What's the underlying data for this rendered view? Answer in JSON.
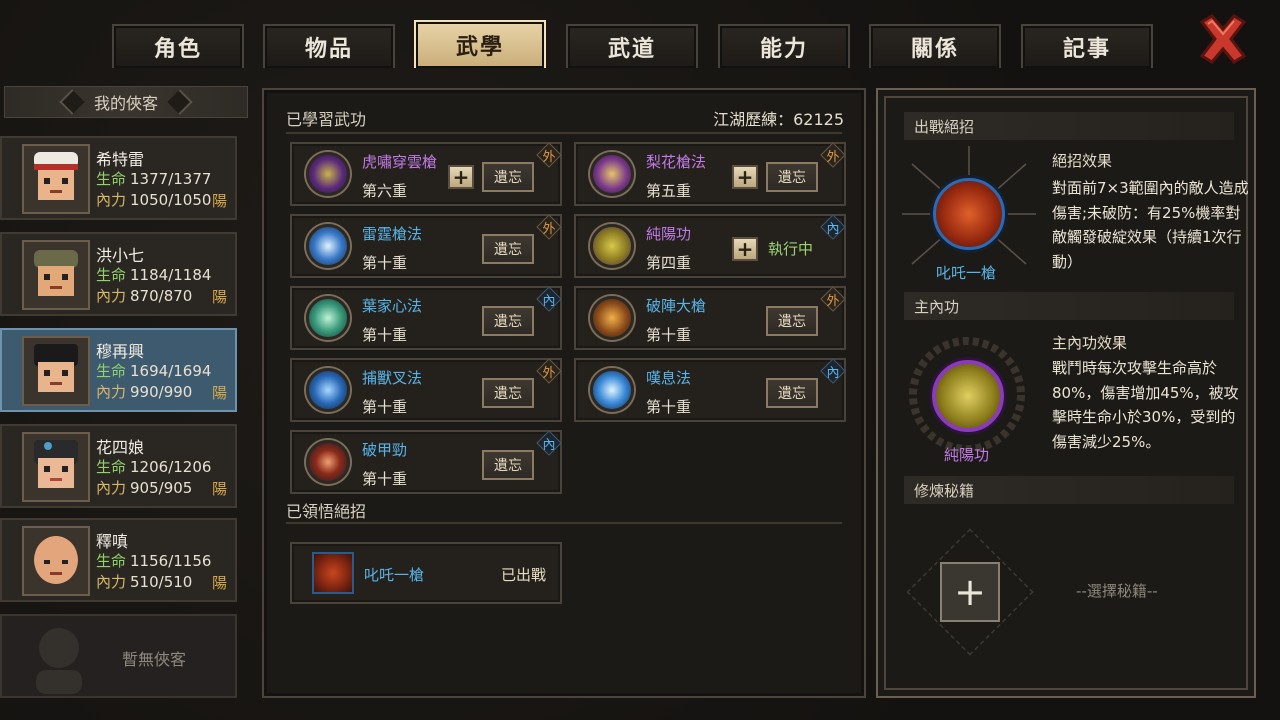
{
  "tabs": [
    "角色",
    "物品",
    "武學",
    "武道",
    "能力",
    "關係",
    "記事"
  ],
  "active_tab": "武學",
  "left": {
    "label": "我的俠客",
    "heroes": [
      {
        "name": "希特雷",
        "hp_label": "生命",
        "hp": "1377/1377",
        "mp_label": "內力",
        "mp": "1050/1050",
        "tag": "陽"
      },
      {
        "name": "洪小七",
        "hp_label": "生命",
        "hp": "1184/1184",
        "mp_label": "內力",
        "mp": "870/870",
        "tag": "陽"
      },
      {
        "name": "穆再興",
        "hp_label": "生命",
        "hp": "1694/1694",
        "mp_label": "內力",
        "mp": "990/990",
        "tag": "陽"
      },
      {
        "name": "花四娘",
        "hp_label": "生命",
        "hp": "1206/1206",
        "mp_label": "內力",
        "mp": "905/905",
        "tag": "陽"
      },
      {
        "name": "釋嗔",
        "hp_label": "生命",
        "hp": "1156/1156",
        "mp_label": "內力",
        "mp": "510/510",
        "tag": "陽"
      }
    ],
    "empty_label": "暫無俠客"
  },
  "middle": {
    "learned_title": "已學習武功",
    "exp_label": "江湖歷練：62125",
    "forget_label": "遺忘",
    "plus_label": "+",
    "running_label": "執行中",
    "skills": [
      {
        "name": "虎嘯穿雲槍",
        "level": "第六重",
        "badge": "外",
        "color": "purple"
      },
      {
        "name": "梨花槍法",
        "level": "第五重",
        "badge": "外",
        "color": "purple"
      },
      {
        "name": "雷霆槍法",
        "level": "第十重",
        "badge": "外",
        "color": "blue"
      },
      {
        "name": "純陽功",
        "level": "第四重",
        "badge": "內",
        "color": "purple"
      },
      {
        "name": "葉家心法",
        "level": "第十重",
        "badge": "內",
        "color": "blue"
      },
      {
        "name": "破陣大槍",
        "level": "第十重",
        "badge": "外",
        "color": "blue"
      },
      {
        "name": "捕獸叉法",
        "level": "第十重",
        "badge": "外",
        "color": "blue"
      },
      {
        "name": "嘆息法",
        "level": "第十重",
        "badge": "內",
        "color": "blue"
      },
      {
        "name": "破甲勁",
        "level": "第十重",
        "badge": "內",
        "color": "blue"
      }
    ],
    "ult_title": "已領悟絕招",
    "ult": {
      "name": "叱吒一槍",
      "status": "已出戰"
    }
  },
  "right": {
    "battle_title": "出戰絕招",
    "battle_name": "叱吒一槍",
    "effect_title": "絕招效果",
    "effect_desc": "對面前7×3範圍內的敵人造成傷害;未破防：有25%機率對敵觸發破綻效果（持續1次行動）",
    "inner_title": "主內功",
    "inner_name": "純陽功",
    "inner_effect_title": "主內功效果",
    "inner_effect_desc": "戰鬥時每次攻擊生命高於80%，傷害增加45%，被攻擊時生命小於30%，受到的傷害減少25%。",
    "book_title": "修煉秘籍",
    "book_choose": "--選擇秘籍--",
    "book_plus": "+"
  },
  "colors": {
    "accent": "#c9ad78",
    "purple": "#c27ae6",
    "blue": "#57b4e8",
    "green": "#9ad36f",
    "orange": "#e09a4a"
  }
}
